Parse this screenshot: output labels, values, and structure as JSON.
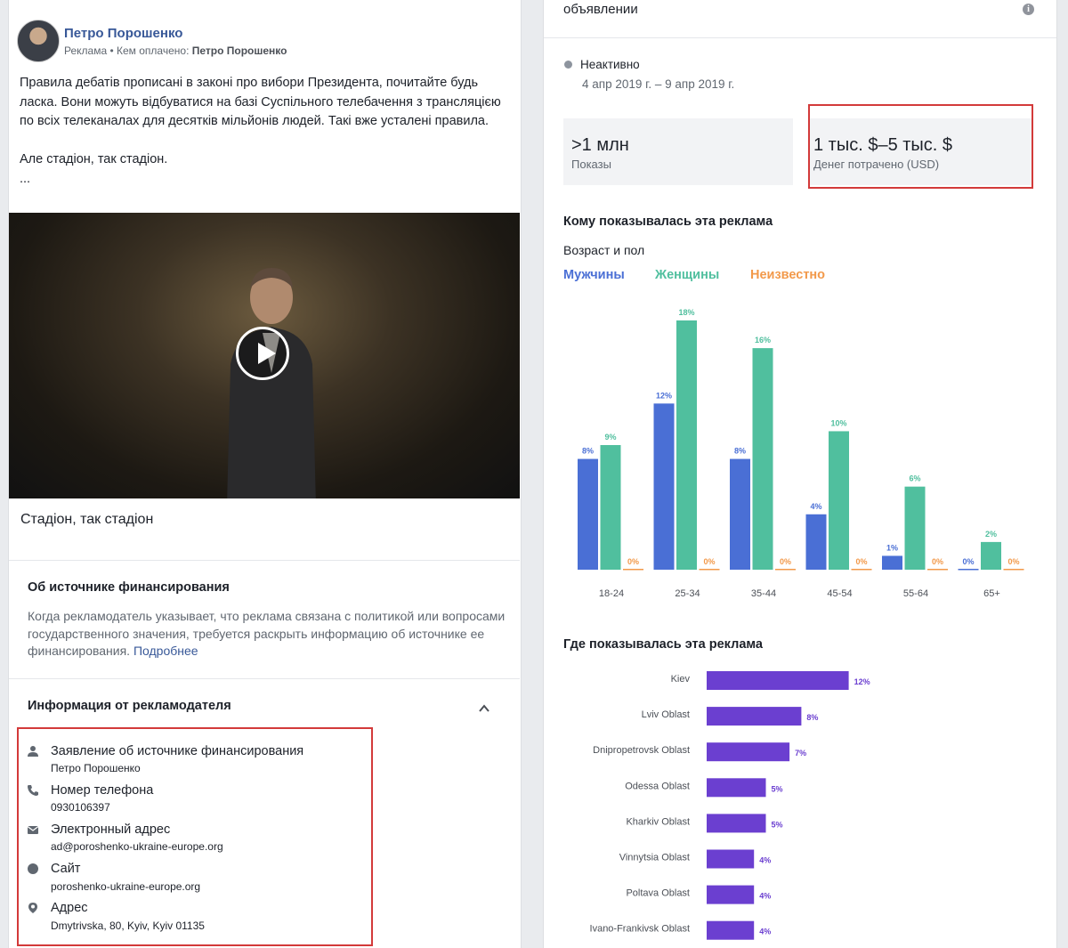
{
  "post": {
    "author": "Петро Порошенко",
    "sub_prefix": "Реклама • Кем оплачено: ",
    "sub_payer": "Петро Порошенко",
    "text": "Правила дебатів прописані в законі про вибори Президента, почитайте будь ласка. Вони можуть відбуватися на базі Суспільного телебачення з трансляцією по всіх телеканалах для десятків мільйонів людей. Такі вже усталені правила.\n\nАле стадіон, так стадіон.\n...",
    "video_caption": "Стадіон, так стадіон",
    "play_icon": "play-icon"
  },
  "funding": {
    "title": "Об источнике финансирования",
    "text": "Когда рекламодатель указывает, что реклама связана с политикой или вопросами государственного значения, требуется раскрыть информацию об источнике ее финансирования.",
    "link": "Подробнее"
  },
  "advertiser": {
    "title": "Информация от рекламодателя",
    "items": [
      {
        "icon": "person-icon",
        "label": "Заявление об источнике финансирования",
        "value": "Петро Порошенко"
      },
      {
        "icon": "phone-icon",
        "label": "Номер телефона",
        "value": "0930106397"
      },
      {
        "icon": "mail-icon",
        "label": "Электронный адрес",
        "value": "ad@poroshenko-ukraine-europe.org"
      },
      {
        "icon": "globe-icon",
        "label": "Сайт",
        "value": "poroshenko-ukraine-europe.org"
      },
      {
        "icon": "pin-icon",
        "label": "Адрес",
        "value": "Dmytrivska, 80, Kyiv, Kyiv 01135"
      }
    ]
  },
  "details": {
    "title": "объявлении",
    "status": "Неактивно",
    "dates": "4 апр 2019 г. – 9 апр 2019 г.",
    "impressions_value": ">1 млн",
    "impressions_label": "Показы",
    "spend_value": "1 тыс. $–5 тыс. $",
    "spend_label": "Денег потрачено (USD)"
  },
  "audience": {
    "title": "Кому показывалась эта реклама",
    "subtitle": "Возраст и пол",
    "legend": [
      "Мужчины",
      "Женщины",
      "Неизвестно"
    ]
  },
  "regions_title": "Где показывалась эта реклама",
  "colors": {
    "male": "#4a6fd5",
    "female": "#50bf9e",
    "unknown": "#f2994a",
    "region": "#6b3fd0",
    "red_box": "#d33a3a",
    "link": "#385898"
  },
  "chart_data": [
    {
      "type": "bar",
      "categories": [
        "18-24",
        "25-34",
        "35-44",
        "45-54",
        "55-64",
        "65+"
      ],
      "series": [
        {
          "name": "Мужчины",
          "values": [
            8,
            12,
            8,
            4,
            1,
            0
          ]
        },
        {
          "name": "Женщины",
          "values": [
            9,
            18,
            16,
            10,
            6,
            2
          ]
        },
        {
          "name": "Неизвестно",
          "values": [
            0,
            0,
            0,
            0,
            0,
            0
          ]
        }
      ],
      "unit": "%",
      "ylim": [
        0,
        18
      ]
    },
    {
      "type": "bar",
      "orientation": "horizontal",
      "categories": [
        "Kiev",
        "Lviv Oblast",
        "Dnipropetrovsk Oblast",
        "Odessa Oblast",
        "Kharkiv Oblast",
        "Vinnytsia Oblast",
        "Poltava Oblast",
        "Ivano-Frankivsk Oblast"
      ],
      "values": [
        12,
        8,
        7,
        5,
        5,
        4,
        4,
        4
      ],
      "unit": "%"
    }
  ]
}
